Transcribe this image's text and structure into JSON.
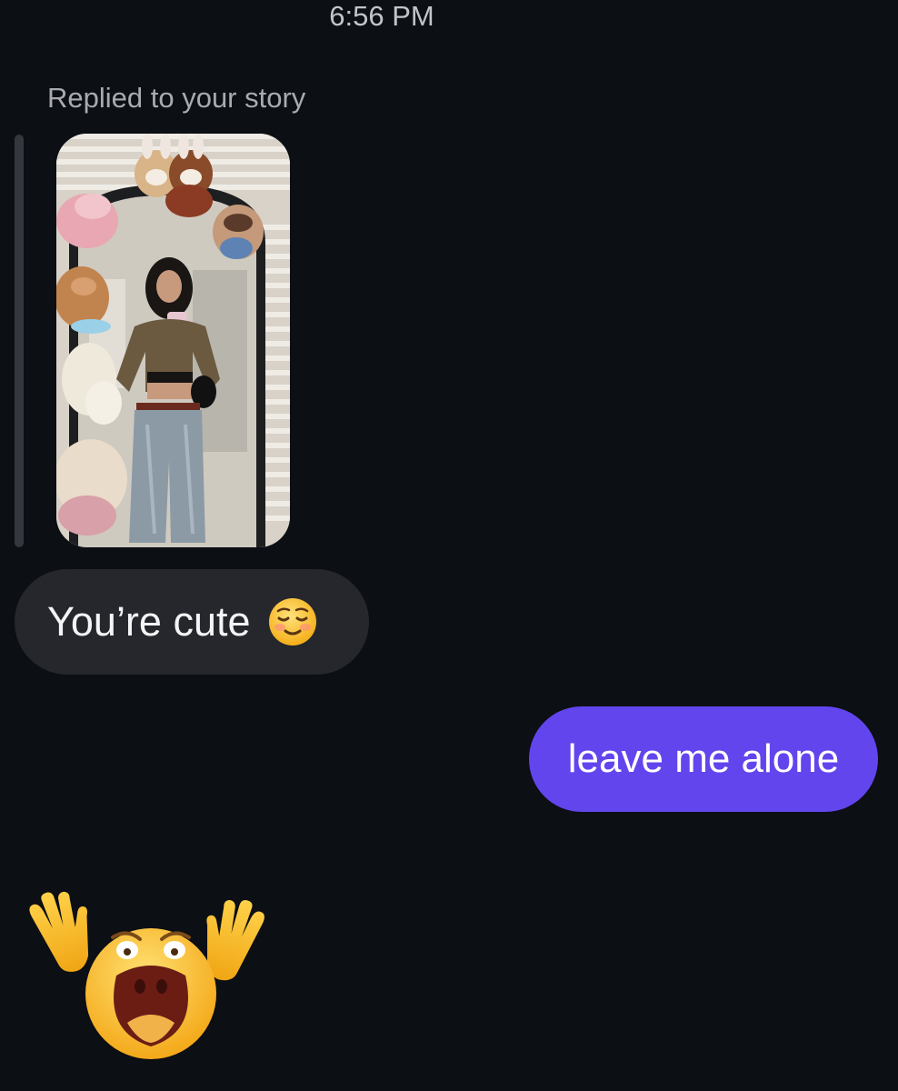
{
  "conversation": {
    "timestamp": "6:56 PM",
    "reply_label": "Replied to your story",
    "incoming": {
      "text": "You’re cute",
      "emoji": "smiling-face-emoji"
    },
    "outgoing": {
      "text": "leave me alone"
    },
    "reaction_sticker": "screaming-face-with-raised-hands-sticker"
  },
  "colors": {
    "background": "#0c0f14",
    "incoming_bubble": "#25272c",
    "outgoing_bubble": "#6345ee",
    "muted_text": "#a9abb0"
  }
}
